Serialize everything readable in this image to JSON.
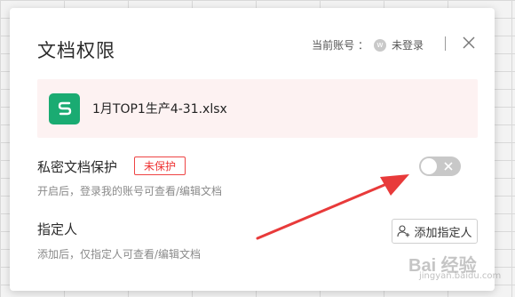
{
  "dialog": {
    "title": "文档权限",
    "account_label": "当前账号 ：",
    "avatar_letter": "w",
    "account_status": "未登录"
  },
  "file": {
    "name": "1月TOP1生产4-31.xlsx",
    "icon_letter": "S",
    "icon_color": "#1aab72"
  },
  "private_protection": {
    "title": "私密文档保护",
    "badge": "未保护",
    "description": "开启后，登录我的账号可查看/编辑文档",
    "toggle_on": false
  },
  "designated_person": {
    "title": "指定人",
    "description": "添加后，仅指定人可查看/编辑文档",
    "add_button_label": "添加指定人"
  },
  "colors": {
    "badge_red": "#e33333",
    "arrow_red": "#e83a3a"
  },
  "watermark": {
    "text": "Bai 经验",
    "sub": "jingyan.baidu.com"
  }
}
